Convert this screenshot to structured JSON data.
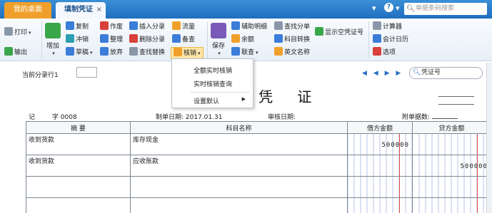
{
  "tabs": {
    "home": "我的桌面",
    "voucher": "填制凭证",
    "close": "×"
  },
  "topbar": {
    "search_placeholder": "单据条码搜索",
    "help": "?",
    "dropdown": "▾"
  },
  "toolbar": {
    "print": "打印",
    "export": "输出",
    "add": "增加",
    "copy": "复制",
    "reverse": "冲销",
    "draft": "草稿",
    "void": "作废",
    "organize": "整理",
    "discard": "放弃",
    "insert_entry": "插入分录",
    "delete_entry": "删除分录",
    "find_replace": "查找替换",
    "flow": "流量",
    "check": "备查",
    "writeoff": "核销",
    "save": "保存",
    "aux_detail": "辅助明细",
    "balance": "余额",
    "link_query": "联查",
    "find_entry": "查找分单",
    "subject_convert": "科目转换",
    "english_name": "英文名称",
    "show_null_voucher": "显示空凭证号",
    "calculator": "计算器",
    "calendar": "会计日历",
    "options": "选项"
  },
  "dropdown_menu": {
    "items": [
      "全额实时核销",
      "实时核销查询",
      "设置默认"
    ]
  },
  "subbar": {
    "current_entry_label": "当前分录行1",
    "voucher_search": "凭证号",
    "nav": "◀ ◀ ▶ ▶"
  },
  "voucher": {
    "title": "凭 证",
    "type_label": "记",
    "no_label": "字",
    "no_value": "0008",
    "date_label": "制单日期:",
    "date_value": "2017.01.31",
    "audit_label": "审核日期:",
    "attach_label": "附单据数:",
    "headers": [
      "摘 要",
      "科目名称",
      "借方金额",
      "贷方金额"
    ],
    "rows": [
      {
        "summary": "收到货款",
        "account": "库存现金",
        "debit": "500000",
        "credit": ""
      },
      {
        "summary": "收到货款",
        "account": "应收账款",
        "debit": "",
        "credit": "500000"
      },
      {
        "summary": "",
        "account": "",
        "debit": "",
        "credit": ""
      },
      {
        "summary": "",
        "account": "",
        "debit": "",
        "credit": ""
      }
    ]
  }
}
